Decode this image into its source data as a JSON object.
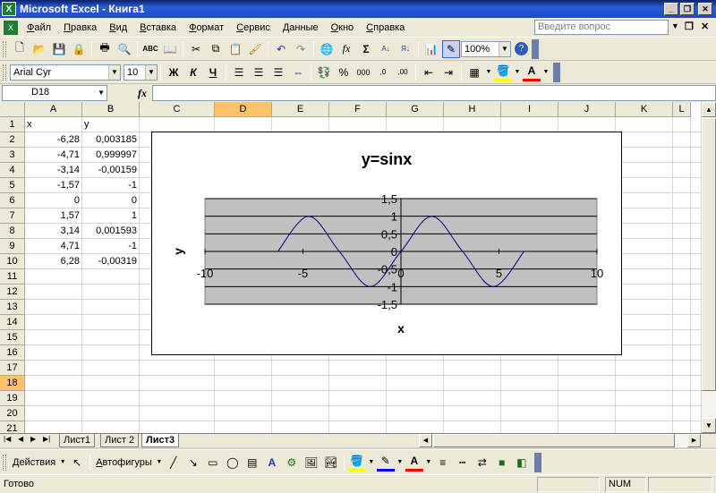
{
  "window": {
    "title": "Microsoft Excel - Книга1",
    "app_icon": "X"
  },
  "menu": {
    "items": [
      "Файл",
      "Правка",
      "Вид",
      "Вставка",
      "Формат",
      "Сервис",
      "Данные",
      "Окно",
      "Справка"
    ],
    "ask_placeholder": "Введите вопрос"
  },
  "toolbar": {
    "zoom": "100%",
    "font_name": "Arial Cyr",
    "font_size": "10",
    "bold": "Ж",
    "italic": "К",
    "underline": "Ч",
    "percent": "%",
    "thousands": "000",
    "fx_label": "fx",
    "sigma": "Σ"
  },
  "formula_bar": {
    "name_box": "D18",
    "fx": "fx",
    "formula": ""
  },
  "sheet": {
    "columns": [
      "A",
      "B",
      "C",
      "D",
      "E",
      "F",
      "G",
      "H",
      "I",
      "J",
      "K",
      "L"
    ],
    "active_column": "D",
    "rows": [
      "1",
      "2",
      "3",
      "4",
      "5",
      "6",
      "7",
      "8",
      "9",
      "10",
      "11",
      "12",
      "13",
      "14",
      "15",
      "16",
      "17",
      "18",
      "19",
      "20",
      "21"
    ],
    "active_row": "18",
    "cells": {
      "A1": "x",
      "B1": "y",
      "A2": "-6,28",
      "B2": "0,003185",
      "A3": "-4,71",
      "B3": "0,999997",
      "A4": "-3,14",
      "B4": "-0,00159",
      "A5": "-1,57",
      "B5": "-1",
      "A6": "0",
      "B6": "0",
      "A7": "1,57",
      "B7": "1",
      "A8": "3,14",
      "B8": "0,001593",
      "A9": "4,71",
      "B9": "-1",
      "A10": "6,28",
      "B10": "-0,00319"
    }
  },
  "chart_data": {
    "type": "line",
    "title": "y=sinx",
    "xlabel": "x",
    "ylabel": "y",
    "x": [
      -6.28,
      -4.71,
      -3.14,
      -1.57,
      0,
      1.57,
      3.14,
      4.71,
      6.28
    ],
    "series": [
      {
        "values": [
          0.003185,
          0.999997,
          -0.00159,
          -1,
          0,
          1,
          0.001593,
          -1,
          -0.00319
        ]
      }
    ],
    "xlim": [
      -10,
      10
    ],
    "ylim": [
      -1.5,
      1.5
    ],
    "x_ticks": [
      "-10",
      "-5",
      "0",
      "5",
      "10"
    ],
    "y_ticks": [
      "1,5",
      "1",
      "0,5",
      "0",
      "-0,5",
      "-1",
      "-1,5"
    ],
    "plot_area_color": "#c0c0c0",
    "line_color": "#000080",
    "smooth": true,
    "grid": true
  },
  "tabs": {
    "items": [
      "Лист1",
      "Лист 2",
      "Лист3"
    ],
    "active": "Лист3"
  },
  "drawing": {
    "actions_label": "Действия",
    "autoshapes_label": "Автофигуры"
  },
  "status": {
    "text": "Готово",
    "num": "NUM"
  }
}
